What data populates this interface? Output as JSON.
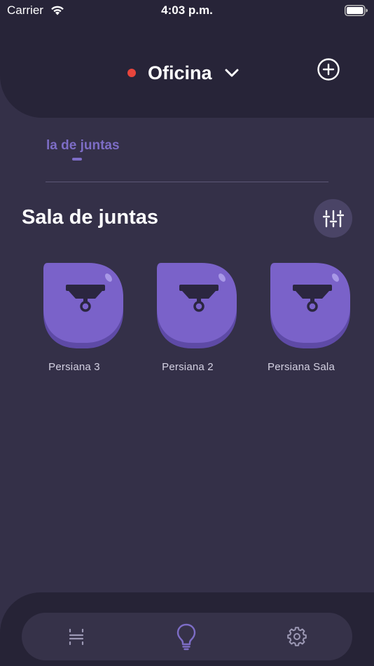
{
  "status_bar": {
    "carrier": "Carrier",
    "time": "4:03 p.m.",
    "icons": [
      "wifi-icon",
      "battery-icon"
    ]
  },
  "header": {
    "location_name": "Oficina",
    "status_color": "#e8453c",
    "icons": [
      "chevron-down-icon",
      "add-circle-icon"
    ]
  },
  "room_tabs": [
    {
      "label": "la de juntas",
      "active": true
    }
  ],
  "section": {
    "title": "Sala de juntas",
    "filter_icon": "sliders-icon"
  },
  "devices": [
    {
      "label": "Persiana 3",
      "icon": "blind-icon"
    },
    {
      "label": "Persiana 2",
      "icon": "blind-icon"
    },
    {
      "label": "Persiana Sala",
      "icon": "blind-icon"
    }
  ],
  "bottom_nav": [
    {
      "icon": "scenes-icon",
      "active": false
    },
    {
      "icon": "bulb-icon",
      "active": true
    },
    {
      "icon": "gear-icon",
      "active": false
    }
  ],
  "colors": {
    "background": "#343048",
    "header": "#272438",
    "accent": "#7d6dc6",
    "device_tile": "#7a62c9"
  }
}
